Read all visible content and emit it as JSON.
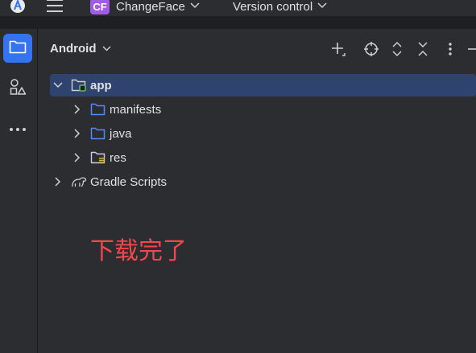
{
  "titlebar": {
    "project_badge": "CF",
    "project_name": "ChangeFace",
    "vcs_label": "Version control",
    "colors": {
      "badge": "#a25be5",
      "background": "#2b2d30"
    }
  },
  "toolstrip": {
    "items": [
      {
        "icon": "folder-icon",
        "active": true
      },
      {
        "icon": "structure-icon",
        "active": false
      },
      {
        "icon": "more-icon",
        "active": false
      }
    ],
    "accent": "#3574f0"
  },
  "panel": {
    "view_selector": "Android",
    "toolbar_icons": [
      "add-icon",
      "locate-icon",
      "expand-all-icon",
      "collapse-all-icon",
      "options-icon",
      "minimize-icon"
    ]
  },
  "tree": {
    "app": "app",
    "manifests": "manifests",
    "java": "java",
    "res": "res",
    "gradle": "Gradle Scripts"
  },
  "annotation": {
    "text": "下载完了",
    "color": "#f2474d"
  }
}
